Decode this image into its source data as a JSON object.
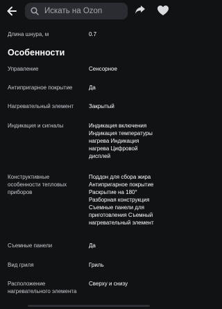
{
  "header": {
    "search_placeholder": "Искать на Ozon",
    "back_icon": "arrow-left-icon",
    "share_icon": "share-icon",
    "favorite_icon": "heart-icon"
  },
  "specs": {
    "cord_length": {
      "label": "Длина шнура, м",
      "value": "0.7"
    },
    "section_title": "Особенности",
    "items": [
      {
        "label": "Управление",
        "value": "Сенсорное"
      },
      {
        "label": "Антипригарное покрытие",
        "value": "Да"
      },
      {
        "label": "Нагревательный элемент",
        "value": "Закрытый"
      },
      {
        "label": "Индикация и сигналы",
        "value_lines": [
          "Индикация включения",
          "Индикация температуры",
          "нагрева Индикация",
          "нагрева Цифровой",
          "дисплей"
        ]
      },
      {
        "label_lines": [
          "Конструктивные",
          "особенности тепловых",
          "приборов"
        ],
        "value_lines": [
          "Поддон для сбора жира",
          "Антипригарное покрытие",
          "Раскрытие на 180°",
          "Разборная конструкция",
          "Съемные панели для",
          "приготовления Съемный",
          "нагревательный элемент"
        ]
      },
      {
        "label": "Съемные панели",
        "value": "Да"
      },
      {
        "label": "Вид гриля",
        "value": "Гриль"
      },
      {
        "label_lines": [
          "Расположение",
          "нагревательного элемента"
        ],
        "value": "Сверху и снизу"
      }
    ]
  },
  "colors": {
    "background": "#111214",
    "search_bg": "#2a2c31",
    "label_text": "#c7cbd1",
    "value_text": "#ffffff"
  }
}
